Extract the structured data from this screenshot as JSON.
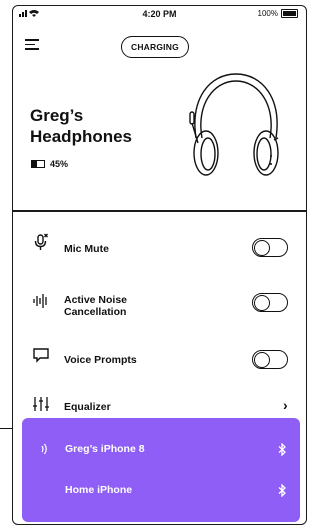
{
  "status_bar": {
    "time": "4:20 PM",
    "battery": "100%"
  },
  "header": {
    "charging_label": "CHARGING"
  },
  "device": {
    "name_line1": "Greg’s",
    "name_line2": "Headphones",
    "battery_text": "45%",
    "battery_fraction": 0.45
  },
  "settings": [
    {
      "label": "Mic Mute",
      "icon": "mic-icon",
      "toggle": false
    },
    {
      "label_line1": "Active Noise",
      "label_line2": "Cancellation",
      "icon": "noise-cancellation-icon",
      "toggle": false
    },
    {
      "label": "Voice Prompts",
      "icon": "speech-bubble-icon",
      "toggle": false
    },
    {
      "label": "Equalizer",
      "icon": "equalizer-icon",
      "chevron": "›"
    }
  ],
  "connections": [
    {
      "label": "Greg’s iPhone 8",
      "active": true,
      "icon": "bluetooth-icon"
    },
    {
      "label": "Home iPhone",
      "active": false,
      "icon": "bluetooth-icon"
    }
  ],
  "colors": {
    "accent": "#8e5ef6",
    "text": "#111111",
    "panel_text": "#ffffff"
  }
}
